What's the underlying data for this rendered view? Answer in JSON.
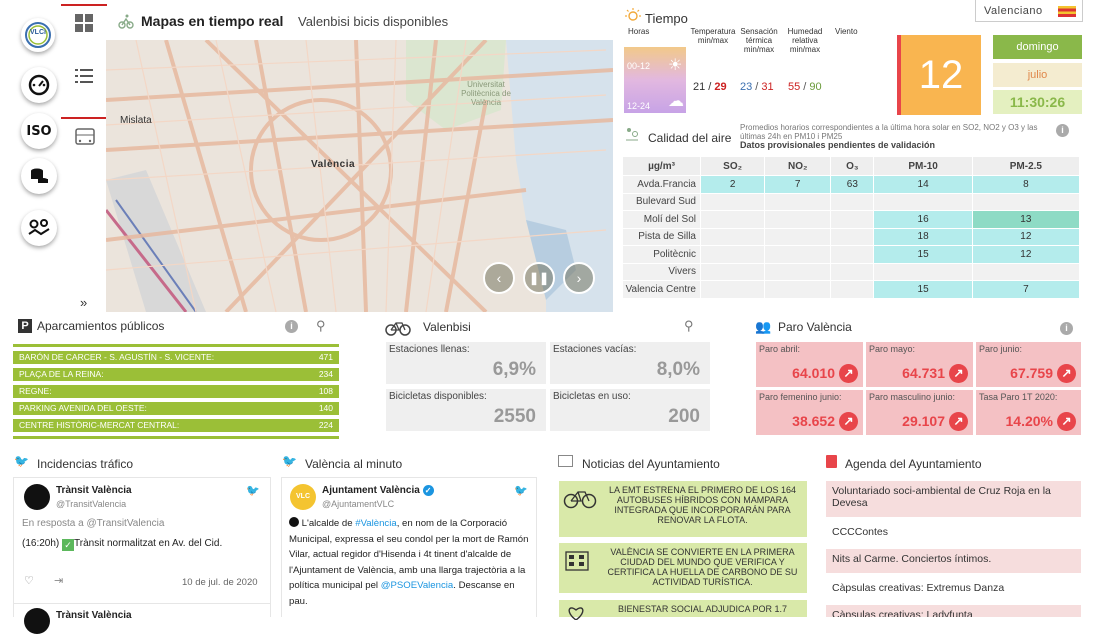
{
  "sidebar": {
    "logo_text": "VLCi",
    "iso_label": "ISO",
    "collapse": "»"
  },
  "map": {
    "title": "Mapas en tiempo real",
    "subtitle": "Valenbisi bicis disponibles",
    "labels": {
      "mislata": "Mislata",
      "valencia": "València",
      "upv": "Universitat Politècnica de València"
    }
  },
  "language": {
    "label": "Valenciano"
  },
  "weather": {
    "title": "Tiempo",
    "headers": {
      "horas": "Horas",
      "temp": "Temperatura min/max",
      "sens": "Sensación térmica min/max",
      "hum": "Humedad relativa min/max",
      "wind": "Viento"
    },
    "rows": [
      "00-12",
      "12-24"
    ],
    "temp_min": "21",
    "temp_max": "29",
    "sens_min": "23",
    "sens_max": "31",
    "hum_min": "55",
    "hum_max": "90",
    "day_number": "12",
    "weekday": "domingo",
    "month": "julio",
    "time": "11:30:26"
  },
  "air": {
    "title": "Calidad del aire",
    "note": "Promedios horarios correspondientes a la última hora solar en SO2, NO2 y O3 y las últimas 24h en PM10 i PM25",
    "note_bold": "Datos provisionales pendientes de validación",
    "columns": [
      "µg/m³",
      "SO₂",
      "NO₂",
      "O₃",
      "PM-10",
      "PM-2.5"
    ],
    "rows": [
      {
        "station": "Avda.Francia",
        "so2": "2",
        "no2": "7",
        "o3": "63",
        "pm10": "14",
        "pm25": "8"
      },
      {
        "station": "Bulevard Sud",
        "so2": "",
        "no2": "",
        "o3": "",
        "pm10": "",
        "pm25": ""
      },
      {
        "station": "Molí del Sol",
        "so2": "",
        "no2": "",
        "o3": "",
        "pm10": "16",
        "pm25": "13"
      },
      {
        "station": "Pista de Silla",
        "so2": "",
        "no2": "",
        "o3": "",
        "pm10": "18",
        "pm25": "12"
      },
      {
        "station": "Politècnic",
        "so2": "",
        "no2": "",
        "o3": "",
        "pm10": "15",
        "pm25": "12"
      },
      {
        "station": "Vivers",
        "so2": "",
        "no2": "",
        "o3": "",
        "pm10": "",
        "pm25": ""
      },
      {
        "station": "Valencia Centre",
        "so2": "",
        "no2": "",
        "o3": "",
        "pm10": "15",
        "pm25": "7"
      }
    ]
  },
  "parking": {
    "title": "Aparcamientos públicos",
    "rows": [
      {
        "name": "BARÓN DE CARCER - S. AGUSTÍN - S. VICENTE:",
        "value": "471"
      },
      {
        "name": "PLAÇA DE LA REINA:",
        "value": "234"
      },
      {
        "name": "REGNE:",
        "value": "108"
      },
      {
        "name": "PARKING AVENIDA DEL OESTE:",
        "value": "140"
      },
      {
        "name": "CENTRE HISTÒRIC-MERCAT CENTRAL:",
        "value": "224"
      }
    ]
  },
  "valenbisi": {
    "title": "Valenbisi",
    "llenas_label": "Estaciones llenas:",
    "llenas": "6,9%",
    "vacias_label": "Estaciones vacías:",
    "vacias": "8,0%",
    "disp_label": "Bicicletas disponibles:",
    "disp": "2550",
    "uso_label": "Bicicletas en uso:",
    "uso": "200"
  },
  "paro": {
    "title": "Paro València",
    "items": [
      {
        "label": "Paro abril:",
        "value": "64.010"
      },
      {
        "label": "Paro mayo:",
        "value": "64.731"
      },
      {
        "label": "Paro junio:",
        "value": "67.759"
      },
      {
        "label": "Paro femenino junio:",
        "value": "38.652"
      },
      {
        "label": "Paro masculino junio:",
        "value": "29.107"
      },
      {
        "label": "Tasa Paro 1T 2020:",
        "value": "14.20%"
      }
    ]
  },
  "traffic": {
    "title": "Incidencias tráfico",
    "tweet": {
      "name": "Trànsit València",
      "handle": "@TransitValencia",
      "reply": "En resposta a @TransitValencia",
      "text_time": "(16:20h)",
      "text": "Trànsit normalitzat en Av. del Cid.",
      "date": "10 de jul. de 2020"
    },
    "next_name": "Trànsit València"
  },
  "minuto": {
    "title": "València al minuto",
    "tweet": {
      "name": "Ajuntament València",
      "handle": "@AjuntamentVLC",
      "t1": "L'alcalde de ",
      "link1": "#València",
      "t2": ", en nom de la Corporació Municipal, expressa el seu condol per la mort de Ramón Vilar, actual regidor d'Hisenda i 4t tinent d'alcalde de l'Ajuntament de València, amb una llarga trajectòria a la política municipal pel ",
      "link2": "@PSOEValencia",
      "t3": ". Descanse en pau."
    }
  },
  "noticias": {
    "title": "Noticias del Ayuntamiento",
    "items": [
      "LA EMT ESTRENA EL PRIMERO DE LOS 164 AUTOBUSES HÍBRIDOS CON MAMPARA INTEGRADA QUE INCORPORARÁN PARA RENOVAR LA FLOTA.",
      "VALÈNCIA SE CONVIERTE EN LA PRIMERA CIUDAD DEL MUNDO QUE VERIFICA Y CERTIFICA LA HUELLA DE CARBONO DE SU ACTIVIDAD TURÍSTICA.",
      "BIENESTAR SOCIAL ADJUDICA POR 1.7"
    ]
  },
  "agenda": {
    "title": "Agenda del Ayuntamiento",
    "items": [
      "Voluntariado soci-ambiental de Cruz Roja en la Devesa",
      "CCCContes",
      "Nits al Carme. Conciertos íntimos.",
      "Càpsulas creativas: Extremus Danza",
      "Càpsulas creativas: Ladyfunta"
    ]
  },
  "colors": {
    "accent_green": "#9bbf37",
    "paro_red": "#e8454a",
    "weather_orange": "#f9b550"
  }
}
